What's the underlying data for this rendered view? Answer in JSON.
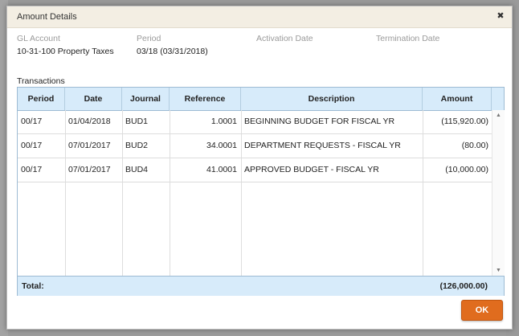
{
  "dialog": {
    "title": "Amount Details",
    "close_glyph": "✖",
    "close_icon": "close-icon",
    "ok_label": "OK",
    "accent_color": "#e06c1e"
  },
  "fields": [
    {
      "label": "GL Account",
      "value": "10-31-100 Property Taxes"
    },
    {
      "label": "Period",
      "value": "03/18 (03/31/2018)"
    },
    {
      "label": "Activation Date",
      "value": ""
    },
    {
      "label": "Termination Date",
      "value": ""
    }
  ],
  "transactions": {
    "section_label": "Transactions",
    "columns": [
      "Period",
      "Date",
      "Journal",
      "Reference",
      "Description",
      "Amount"
    ],
    "rows": [
      {
        "period": "00/17",
        "date": "01/04/2018",
        "journal": "BUD1",
        "reference": "1.0001",
        "description": "BEGINNING BUDGET FOR FISCAL YR",
        "amount": "(115,920.00)"
      },
      {
        "period": "00/17",
        "date": "07/01/2017",
        "journal": "BUD2",
        "reference": "34.0001",
        "description": "DEPARTMENT REQUESTS - FISCAL YR",
        "amount": "(80.00)"
      },
      {
        "period": "00/17",
        "date": "07/01/2017",
        "journal": "BUD4",
        "reference": "41.0001",
        "description": "APPROVED BUDGET - FISCAL YR",
        "amount": "(10,000.00)"
      }
    ],
    "total_label": "Total:",
    "total_value": "(126,000.00)",
    "scroll_up_glyph": "▲",
    "scroll_down_glyph": "▼"
  }
}
